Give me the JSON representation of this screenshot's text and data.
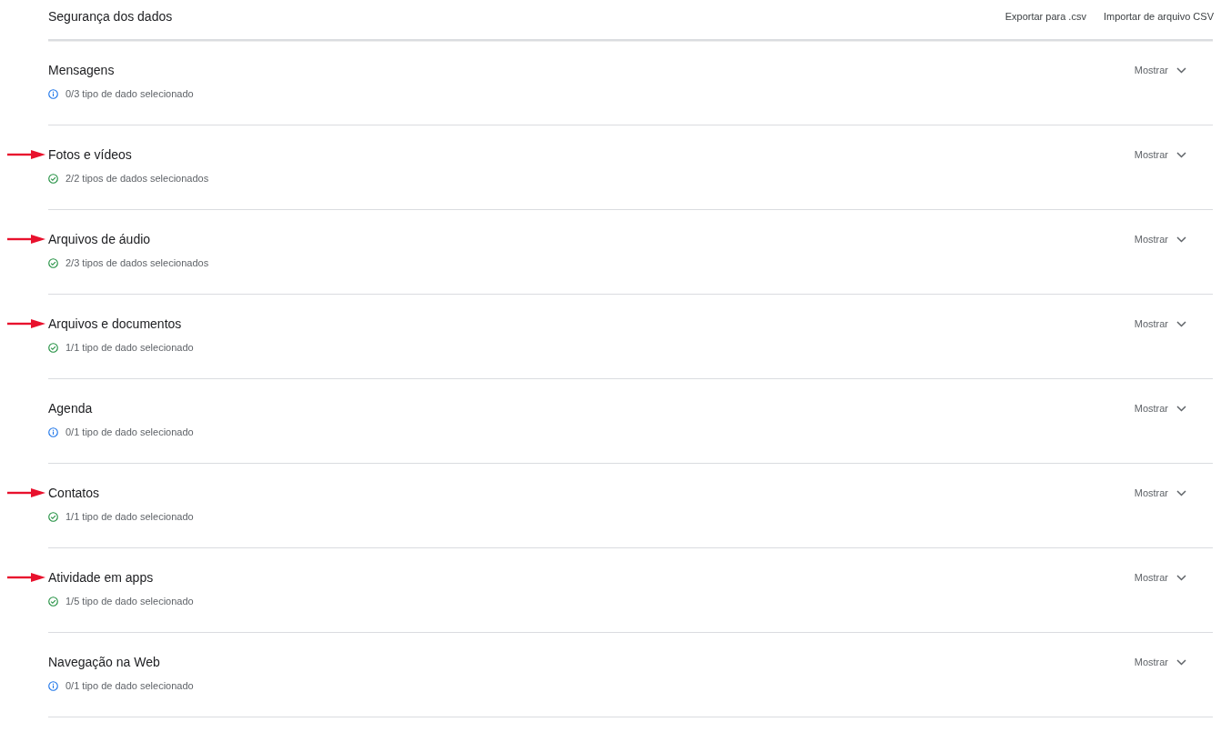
{
  "header": {
    "title": "Segurança dos dados",
    "actions": [
      "Exportar para .csv",
      "Importar de arquivo CSV"
    ]
  },
  "sections": [
    {
      "title": "Mensagens",
      "status": "0/3 tipo de dado selecionado",
      "kind": "info",
      "marked": false,
      "toggle": "Mostrar",
      "expanded": false
    },
    {
      "title": "Fotos e vídeos",
      "status": "2/2 tipos de dados selecionados",
      "kind": "check",
      "marked": true,
      "toggle": "Mostrar",
      "expanded": false
    },
    {
      "title": "Arquivos de áudio",
      "status": "2/3 tipos de dados selecionados",
      "kind": "check",
      "marked": true,
      "toggle": "Mostrar",
      "expanded": false
    },
    {
      "title": "Arquivos e documentos",
      "status": "1/1 tipo de dado selecionado",
      "kind": "check",
      "marked": true,
      "toggle": "Mostrar",
      "expanded": false
    },
    {
      "title": "Agenda",
      "status": "0/1 tipo de dado selecionado",
      "kind": "info",
      "marked": false,
      "toggle": "Mostrar",
      "expanded": false
    },
    {
      "title": "Contatos",
      "status": "1/1 tipo de dado selecionado",
      "kind": "check",
      "marked": true,
      "toggle": "Mostrar",
      "expanded": false
    },
    {
      "title": "Atividade em apps",
      "status": "1/5 tipo de dado selecionado",
      "kind": "check",
      "marked": true,
      "toggle": "Mostrar",
      "expanded": false
    },
    {
      "title": "Navegação na Web",
      "status": "0/1 tipo de dado selecionado",
      "kind": "info",
      "marked": false,
      "toggle": "Mostrar",
      "expanded": false
    }
  ]
}
